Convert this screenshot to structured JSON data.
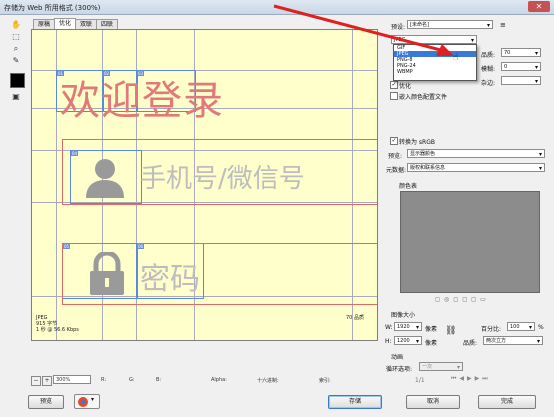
{
  "window": {
    "title": "存储为 Web 所用格式 (300%)",
    "close_icon": "close-icon"
  },
  "left_toolbar": {
    "tools": [
      "hand-icon",
      "slice-select-icon",
      "zoom-icon",
      "eyedropper-icon"
    ],
    "swatch_color": "#000000"
  },
  "tabs": [
    "原稿",
    "优化",
    "双联",
    "四联"
  ],
  "canvas": {
    "title_text": "欢迎登录",
    "phone_placeholder": "手机号/微信号",
    "password_placeholder": "密码",
    "slice_tags": [
      "01",
      "02",
      "03",
      "04",
      "05",
      "06",
      "07"
    ]
  },
  "image_info": {
    "left": [
      "JPEG",
      "915 字节",
      "1 秒 @ 56.6 Kbps"
    ],
    "right": "70 品质"
  },
  "status_bar": {
    "zoom": "300%",
    "r": "R:",
    "g": "G:",
    "b": "B:",
    "alpha": "Alpha:",
    "hex": "十六进制:",
    "index": "索引:"
  },
  "bottom_buttons": {
    "preview": "预览",
    "save": "存储",
    "cancel": "取消",
    "done": "完成"
  },
  "panel": {
    "preset_label": "预设:",
    "preset_value": "[未命名]",
    "format_value": "JPEG",
    "format_options": [
      "GIF",
      "JPEG",
      "PNG-8",
      "PNG-24",
      "WBMP"
    ],
    "format_highlight_index": 1,
    "quality_label": "品质:",
    "quality_value": "70",
    "blur_label": "模糊:",
    "blur_value": "0",
    "matte_label": "杂边:",
    "optimized_label": "优化",
    "embed_profile_label": "嵌入颜色配置文件",
    "convert_srgb_label": "转换为 sRGB",
    "preview_label": "预览:",
    "preview_value": "显示器颜色",
    "metadata_label": "元数据:",
    "metadata_value": "版权和联系信息",
    "color_table_label": "颜色表",
    "image_size_label": "图像大小",
    "w_label": "W:",
    "w_value": "1920",
    "h_label": "H:",
    "h_value": "1200",
    "unit": "像素",
    "percent_label": "百分比:",
    "percent_value": "100",
    "percent_unit": "%",
    "quality2_label": "品质:",
    "quality2_value": "两次立方",
    "animation_label": "动画",
    "loop_label": "循环选项:",
    "loop_value": "一次",
    "frame_counter": "1/1"
  }
}
